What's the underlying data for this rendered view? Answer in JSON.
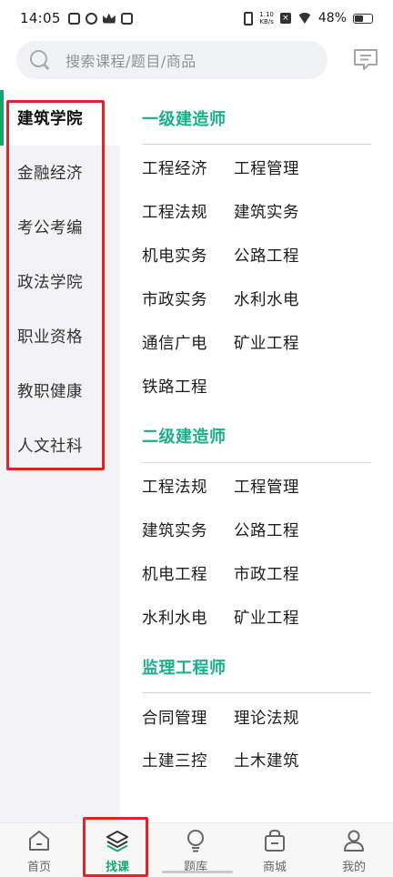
{
  "status_bar": {
    "time": "14:05",
    "net_speed_value": "1.10",
    "net_speed_unit": "KB/s",
    "battery": "48%"
  },
  "search": {
    "placeholder": "搜索课程/题目/商品"
  },
  "categories": [
    {
      "label": "建筑学院",
      "active": true
    },
    {
      "label": "金融经济",
      "active": false
    },
    {
      "label": "考公考编",
      "active": false
    },
    {
      "label": "政法学院",
      "active": false
    },
    {
      "label": "职业资格",
      "active": false
    },
    {
      "label": "教职健康",
      "active": false
    },
    {
      "label": "人文社科",
      "active": false
    }
  ],
  "sections": [
    {
      "title": "一级建造师",
      "items": [
        "工程经济",
        "工程管理",
        "工程法规",
        "建筑实务",
        "机电实务",
        "公路工程",
        "市政实务",
        "水利水电",
        "通信广电",
        "矿业工程",
        "铁路工程"
      ]
    },
    {
      "title": "二级建造师",
      "items": [
        "工程法规",
        "工程管理",
        "建筑实务",
        "公路工程",
        "机电工程",
        "市政工程",
        "水利水电",
        "矿业工程"
      ]
    },
    {
      "title": "监理工程师",
      "items": [
        "合同管理",
        "理论法规",
        "土建三控",
        "土木建筑"
      ]
    }
  ],
  "tabs": [
    {
      "label": "首页",
      "active": false
    },
    {
      "label": "找课",
      "active": true
    },
    {
      "label": "题库",
      "active": false
    },
    {
      "label": "商城",
      "active": false
    },
    {
      "label": "我的",
      "active": false
    }
  ],
  "colors": {
    "accent": "#19b089",
    "highlight": "#e0222b",
    "sidebar_bg": "#f3f3f5"
  }
}
